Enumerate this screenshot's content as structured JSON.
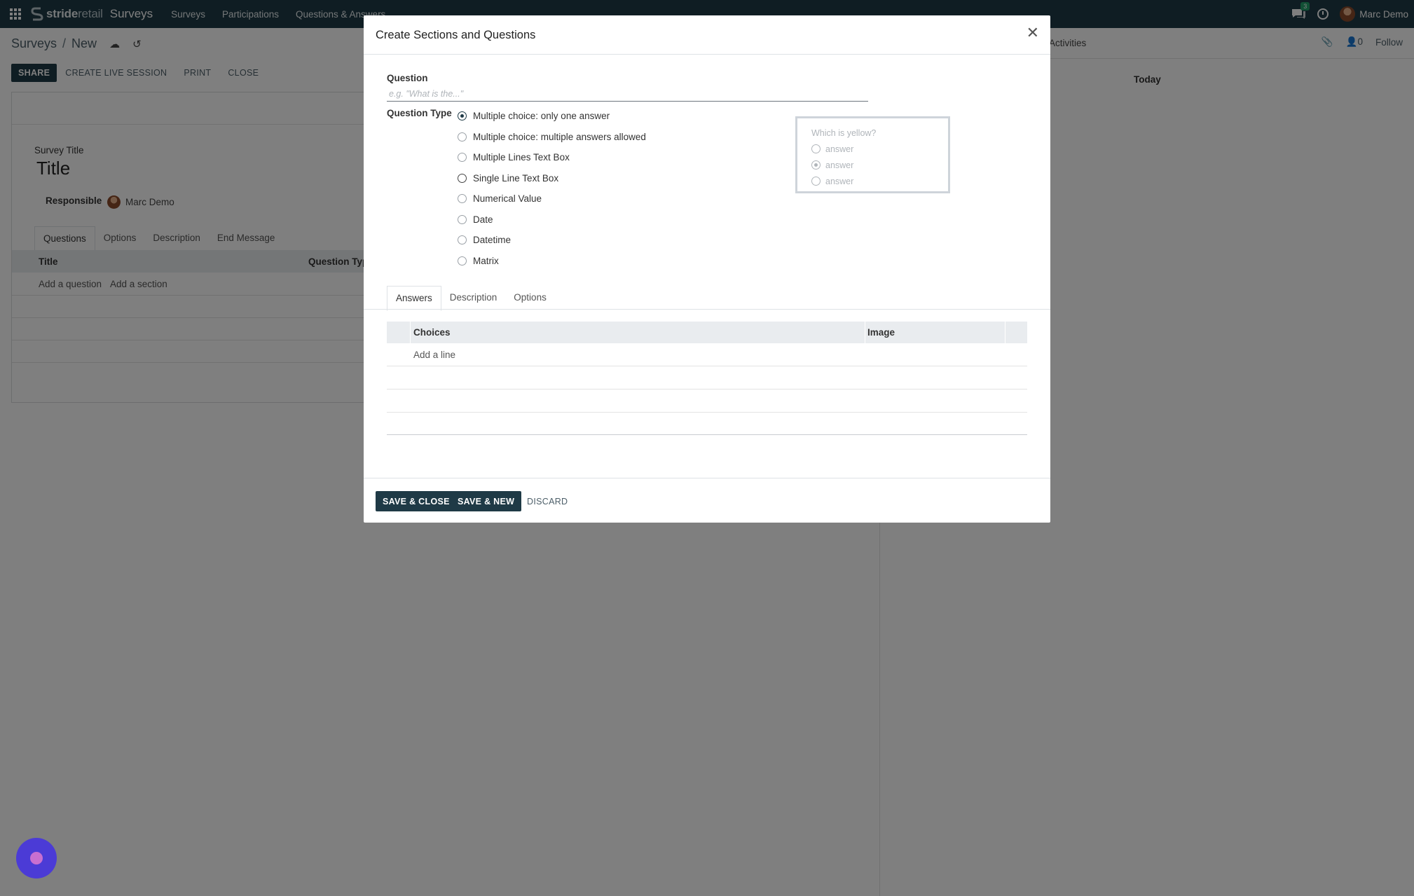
{
  "navbar": {
    "brand_bold": "stride",
    "brand_light": "retail",
    "app_name": "Surveys",
    "menu": [
      "Surveys",
      "Participations",
      "Questions & Answers"
    ],
    "chat_count": "3",
    "user_name": "Marc Demo"
  },
  "breadcrumb": {
    "parent": "Surveys",
    "separator": "/",
    "current": "New"
  },
  "actions": {
    "share": "SHARE",
    "create_live": "CREATE LIVE SESSION",
    "print": "PRINT",
    "close": "CLOSE"
  },
  "chatter": {
    "activities": "Activities",
    "followers_count": "0",
    "follow": "Follow",
    "today": "Today"
  },
  "form": {
    "title_label": "Survey Title",
    "title_value": "Title",
    "responsible_label": "Responsible",
    "responsible_value": "Marc Demo",
    "tabs": [
      "Questions",
      "Options",
      "Description",
      "End Message"
    ],
    "columns": {
      "title": "Title",
      "question_type": "Question Type"
    },
    "add_question": "Add a question",
    "add_section": "Add a section"
  },
  "modal": {
    "title": "Create Sections and Questions",
    "question_label": "Question",
    "question_placeholder": "e.g. \"What is the...\"",
    "question_value": "",
    "question_type_label": "Question Type",
    "question_types": [
      "Multiple choice: only one answer",
      "Multiple choice: multiple answers allowed",
      "Multiple Lines Text Box",
      "Single Line Text Box",
      "Numerical Value",
      "Date",
      "Datetime",
      "Matrix"
    ],
    "selected_type": "Multiple choice: only one answer",
    "preview": {
      "question": "Which is yellow?",
      "options": [
        "answer",
        "answer",
        "answer"
      ],
      "selected_option_index": 1
    },
    "tabs": [
      "Answers",
      "Description",
      "Options"
    ],
    "active_tab": "Answers",
    "answers_columns": {
      "choices": "Choices",
      "image": "Image"
    },
    "add_line": "Add a line",
    "footer": {
      "save_close": "SAVE & CLOSE",
      "save_new": "SAVE & NEW",
      "discard": "DISCARD"
    }
  },
  "colors": {
    "brand_dark": "#1f3a46",
    "badge_green": "#22a06b",
    "help_bubble": "#4b3bd6"
  }
}
